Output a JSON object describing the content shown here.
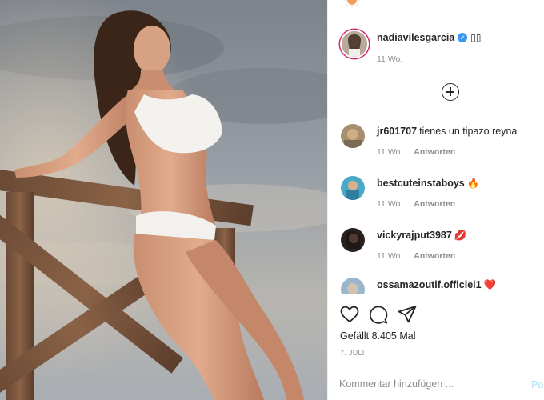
{
  "post": {
    "author": "nadiavilesgarcia",
    "caption_glyphs": "▯▯",
    "age": "11 Wo.",
    "likes_text": "Gefällt 8.405 Mal",
    "date": "7. JULI"
  },
  "comments": [
    {
      "user": "jr601707",
      "text": "tienes un tipazo reyna",
      "emoji": "",
      "age": "11 Wo.",
      "reply": "Antworten"
    },
    {
      "user": "bestcuteinstaboys",
      "text": "",
      "emoji": "🔥",
      "age": "11 Wo.",
      "reply": "Antworten"
    },
    {
      "user": "vickyrajput3987",
      "text": "",
      "emoji": "💋",
      "age": "11 Wo.",
      "reply": "Antworten"
    },
    {
      "user": "ossamazoutif.officiel1",
      "text": "",
      "emoji": "❤️",
      "age": "",
      "reply": ""
    }
  ],
  "comment_box": {
    "placeholder": "Kommentar hinzufügen ...",
    "post_label": "Po"
  },
  "icons": {
    "like": "heart-icon",
    "comment": "comment-bubble-icon",
    "share": "paper-plane-icon",
    "load_more": "plus-circle-icon",
    "verified": "verified-badge-icon"
  },
  "colors": {
    "verified": "#3897f0",
    "story_ring": "#d62976",
    "post_button": "#b2dffc",
    "meta_text": "#8e8e8e"
  }
}
